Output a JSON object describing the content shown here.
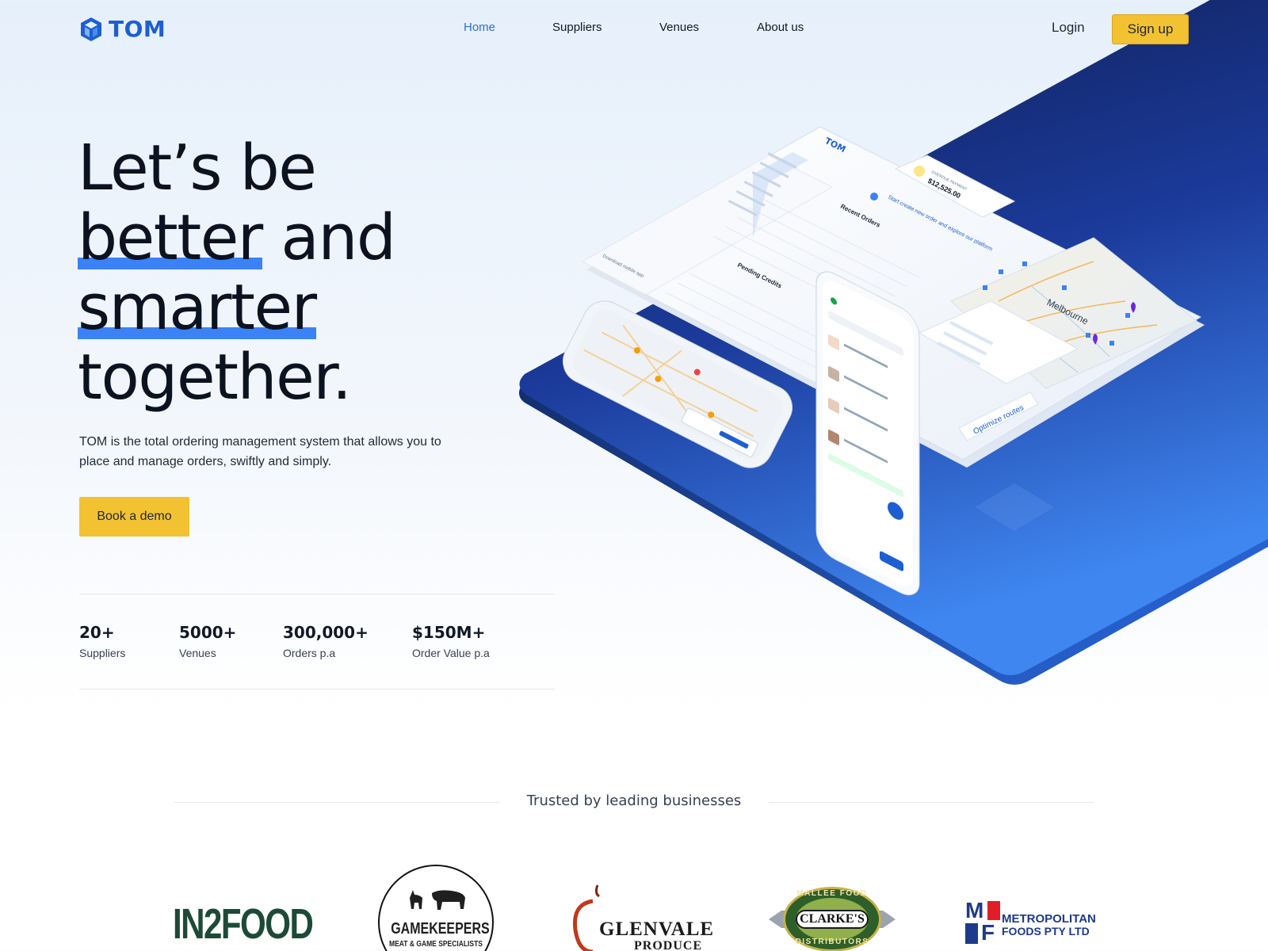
{
  "brand": {
    "name": "TOM",
    "accent": "#1d5fd1",
    "cta_color": "#f2c232",
    "dark_blue": "#0f1e4d"
  },
  "nav": {
    "links": [
      {
        "label": "Home",
        "active": true
      },
      {
        "label": "Suppliers",
        "active": false
      },
      {
        "label": "Venues",
        "active": false
      },
      {
        "label": "About us",
        "active": false
      }
    ],
    "login": "Login",
    "signup": "Sign up"
  },
  "hero": {
    "title_lines": [
      "Let’s be",
      "better",
      "and",
      "smarter",
      "together."
    ],
    "description": "TOM is the total ordering management system that allows you to place and manage orders, swiftly and simply.",
    "cta": "Book a demo"
  },
  "stats": [
    {
      "value": "20+",
      "label": "Suppliers"
    },
    {
      "value": "5000+",
      "label": "Venues"
    },
    {
      "value": "300,000+",
      "label": "Orders p.a"
    },
    {
      "value": "$150M+",
      "label": "Order Value p.a"
    }
  ],
  "illustration": {
    "app_logo": "TOM",
    "payment_label": "OVERDUE PAYMENT",
    "payment_amount": "$12,525.00",
    "create_order_prompt": "Start create new order and explore our platform",
    "recent_orders": "Recent Orders",
    "pending_credits": "Pending Credits",
    "map_city": "Melbourne",
    "optimize_routes": "Optimize routes",
    "download_app": "Download mobile app"
  },
  "trusted": {
    "title": "Trusted by leading businesses",
    "logos": [
      {
        "name": "in2food",
        "text": "IN2FOOD"
      },
      {
        "name": "gamekeepers",
        "text": "GAMEKEEPERS",
        "sub": "MEAT & GAME SPECIALISTS"
      },
      {
        "name": "glenvale",
        "text": "GLENVALE",
        "sub": "PRODUCE"
      },
      {
        "name": "clarkes",
        "text": "CLARKE'S",
        "top": "MALLEE FOOD",
        "bottom": "DISTRIBUTORS"
      },
      {
        "name": "metropolitan",
        "text": "METROPOLITAN",
        "sub": "FOODS PTY LTD",
        "mark_top": "M",
        "mark_bottom": "F"
      }
    ]
  }
}
